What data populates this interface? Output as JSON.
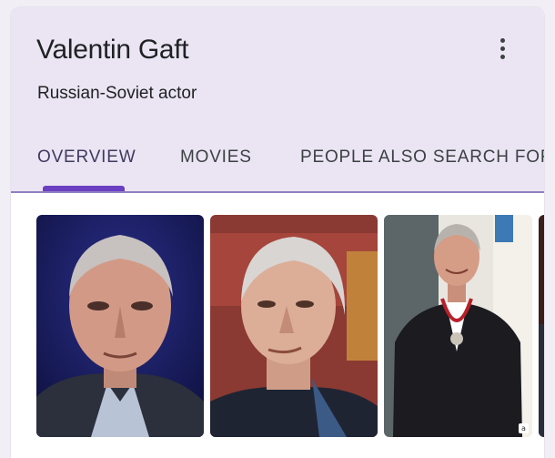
{
  "entity": {
    "name": "Valentin Gaft",
    "description": "Russian-Soviet actor"
  },
  "menu_icon": "more-vert-icon",
  "tabs": [
    {
      "label": "OVERVIEW",
      "active": true
    },
    {
      "label": "MOVIES",
      "active": false
    },
    {
      "label": "PEOPLE ALSO SEARCH FOR",
      "active": false
    }
  ],
  "images": [
    {
      "alt": "portrait-photo-1"
    },
    {
      "alt": "portrait-photo-2"
    },
    {
      "alt": "portrait-photo-3",
      "attribution_label": "a"
    },
    {
      "alt": "portrait-photo-4"
    }
  ],
  "colors": {
    "header_bg": "#ebe5f3",
    "tab_indicator": "#6a3fc1",
    "divider": "#8f7fc2"
  }
}
